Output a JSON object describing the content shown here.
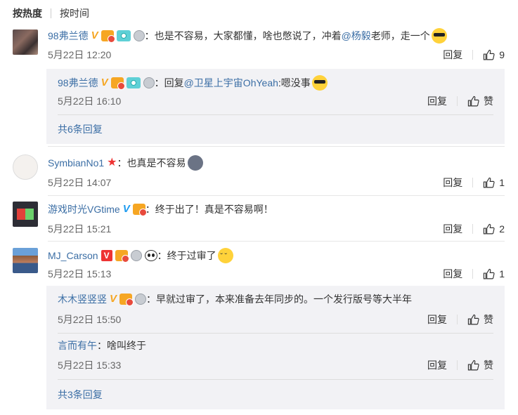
{
  "sort": {
    "hot": "按热度",
    "time": "按时间"
  },
  "labels": {
    "reply": "回复",
    "like_word": "赞"
  },
  "comments": [
    {
      "user": "98弗兰德",
      "text": "：也是不容易，大家都懂，啥也憋说了，冲着",
      "mention": "@杨毅",
      "text2": " 老师，走一个",
      "time": "5月22日 12:20",
      "likes": "9",
      "replies": [
        {
          "user": "98弗兰德",
          "prefix": "：回复",
          "mention": "@卫星上宇宙OhYeah",
          "text": ":嗯没事",
          "time": "5月22日 16:10"
        }
      ],
      "more": "共6条回复"
    },
    {
      "user": "SymbianNo1",
      "text": "：也真是不容易",
      "time": "5月22日 14:07",
      "likes": "1"
    },
    {
      "user": "游戏时光VGtime",
      "text": "：终于出了！真是不容易啊！",
      "time": "5月22日 15:21",
      "likes": "2"
    },
    {
      "user": "MJ_Carson",
      "text": "：终于过审了",
      "time": "5月22日 15:13",
      "likes": "1",
      "replies": [
        {
          "user": "木木竖竖竖",
          "text": "：早就过审了，本来准备去年同步的。一个发行版号等大半年",
          "time": "5月22日 15:50"
        },
        {
          "user": "言而有午",
          "text": "：啥叫终于",
          "time": "5月22日 15:33"
        }
      ],
      "more": "共3条回复"
    }
  ]
}
